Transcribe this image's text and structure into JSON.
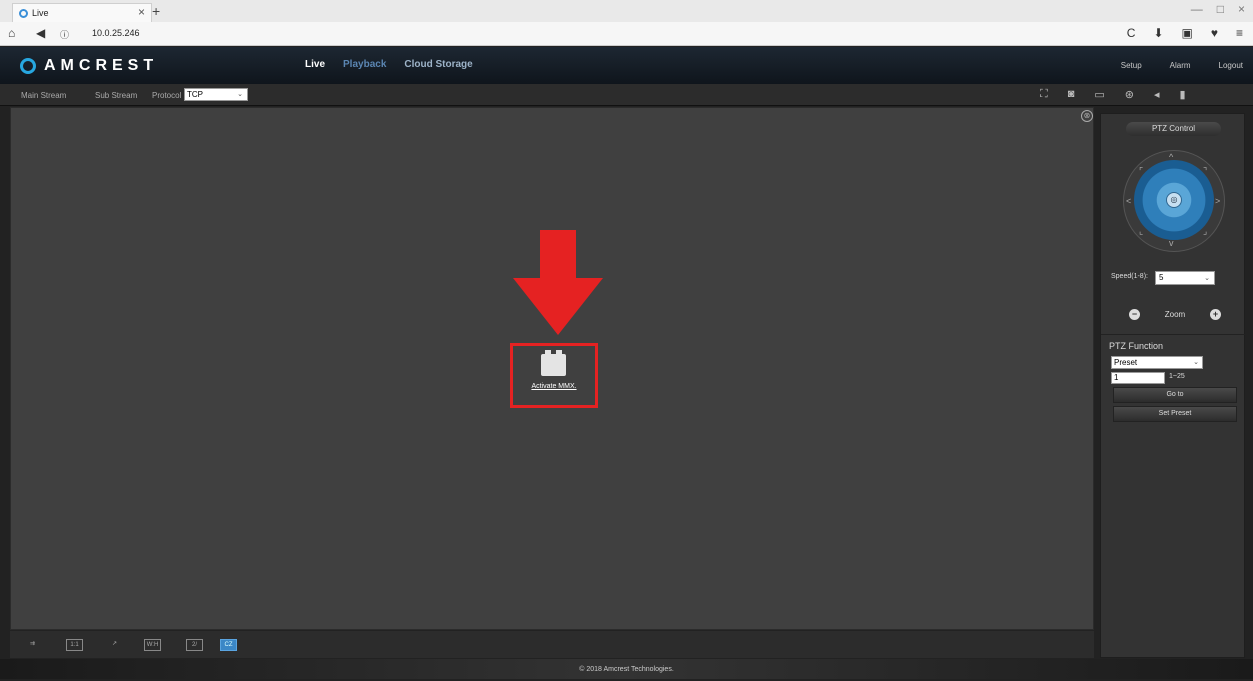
{
  "browser": {
    "tab_title": "Live",
    "tab_close": "×",
    "new_tab": "+",
    "url": "10.0.25.246",
    "window_controls": [
      "—",
      "□",
      "×"
    ],
    "toolbar_icons": [
      "C",
      "⬇",
      "▣",
      "♥",
      "≡"
    ]
  },
  "header": {
    "logo_text": "AMCREST",
    "nav": [
      "Live",
      "Playback",
      "Cloud Storage"
    ],
    "active_nav": "Live",
    "right_nav": [
      "Setup",
      "Alarm",
      "Logout"
    ]
  },
  "streambar": {
    "main_stream": "Main Stream",
    "sub_stream": "Sub Stream",
    "protocol_label": "Protocol",
    "protocol_value": "TCP",
    "chev": "⌄",
    "icons": [
      "fullscreen-icon",
      "snapshot-icon",
      "image-icon",
      "record-icon",
      "audio-icon",
      "microphone-icon"
    ]
  },
  "video": {
    "activate_link": "Activate MMX.",
    "close_glyph": "⊗"
  },
  "bottom_tools": [
    "⇉",
    "1:1",
    "↗",
    "W:H",
    "2/",
    "CZ"
  ],
  "footer": {
    "copyright": "© 2018 Amcrest Technologies."
  },
  "ptz": {
    "title": "PTZ Control",
    "center_glyph": "◎",
    "dirs": [
      "^",
      "v",
      "<",
      ">",
      "⌜",
      "⌝",
      "⌞",
      "⌟"
    ],
    "speed_label": "Speed(1-8):",
    "speed_value": "5",
    "zoom_minus": "−",
    "zoom_label": "Zoom",
    "zoom_plus": "+",
    "function_title": "PTZ Function",
    "function_value": "Preset",
    "preset_number": "1",
    "preset_range": "1~25",
    "goto_button": "Go to",
    "set_preset_button": "Set Preset"
  },
  "colors": {
    "accent_red": "#e52222",
    "accent_blue": "#27a7e0"
  }
}
